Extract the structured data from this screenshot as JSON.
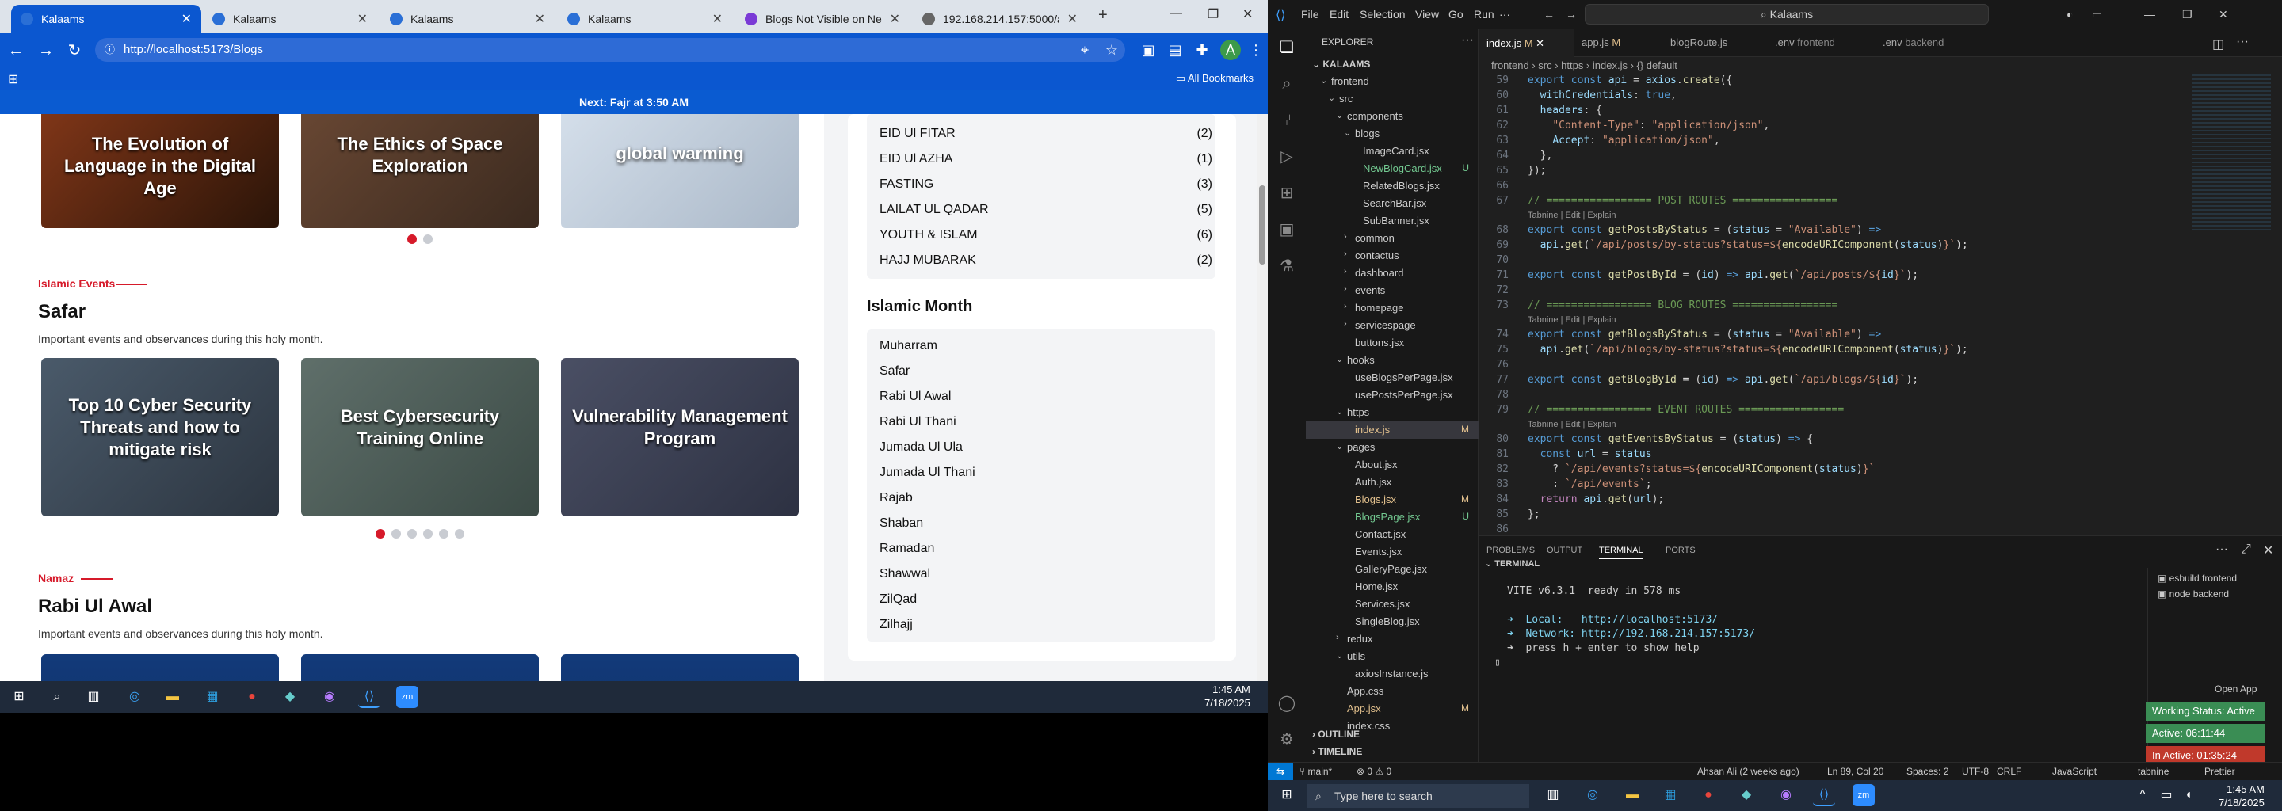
{
  "browser": {
    "tabs": [
      {
        "label": "Kalaams",
        "active": true
      },
      {
        "label": "Kalaams",
        "active": false
      },
      {
        "label": "Kalaams",
        "active": false
      },
      {
        "label": "Kalaams",
        "active": false
      },
      {
        "label": "Blogs Not Visible on Netwo",
        "active": false
      },
      {
        "label": "192.168.214.157:5000/api/b",
        "active": false
      }
    ],
    "url": "http://localhost:5173/Blogs",
    "all_bookmarks": "All Bookmarks",
    "site_banner": "Next: Fajr at 3:50 AM"
  },
  "main": {
    "top_cards": [
      "The Evolution of Language in the Digital Age",
      "The Ethics of Space Exploration",
      "global warming"
    ],
    "section1": {
      "tag": "Islamic Events",
      "title": "Safar",
      "subtitle": "Important events and observances during this holy month.",
      "cards": [
        "Top 10 Cyber Security Threats and how to mitigate risk",
        "Best Cybersecurity Training Online",
        "Vulnerability Management Program"
      ]
    },
    "section2": {
      "tag": "Namaz",
      "title": "Rabi Ul Awal",
      "subtitle": "Important events and observances during this holy month."
    }
  },
  "sidebar": {
    "categories": [
      {
        "name": "EID Ul FITAR",
        "count": "(2)"
      },
      {
        "name": "EID Ul AZHA",
        "count": "(1)"
      },
      {
        "name": "FASTING",
        "count": "(3)"
      },
      {
        "name": "LAILAT UL QADAR",
        "count": "(5)"
      },
      {
        "name": "YOUTH & ISLAM",
        "count": "(6)"
      },
      {
        "name": "HAJJ MUBARAK",
        "count": "(2)"
      }
    ],
    "month_title": "Islamic Month",
    "months": [
      "Muharram",
      "Safar",
      "Rabi Ul Awal",
      "Rabi Ul Thani",
      "Jumada Ul Ula",
      "Jumada Ul Thani",
      "Rajab",
      "Shaban",
      "Ramadan",
      "Shawwal",
      "ZilQad",
      "Zilhajj"
    ]
  },
  "taskbar_left": {
    "time": "1:45 AM",
    "date": "7/18/2025"
  },
  "vscode": {
    "menu": [
      "File",
      "Edit",
      "Selection",
      "View",
      "Go",
      "Run"
    ],
    "search": "Kalaams",
    "explorer_title": "EXPLORER",
    "root": "KALAAMS",
    "tree": [
      {
        "label": "frontend",
        "arrow": "⌄",
        "indent": 1,
        "status": ""
      },
      {
        "label": "src",
        "arrow": "⌄",
        "indent": 2,
        "status": ""
      },
      {
        "label": "components",
        "arrow": "⌄",
        "indent": 3,
        "status": ""
      },
      {
        "label": "blogs",
        "arrow": "⌄",
        "indent": 4,
        "status": ""
      },
      {
        "label": "ImageCard.jsx",
        "arrow": "",
        "indent": 5,
        "status": ""
      },
      {
        "label": "NewBlogCard.jsx",
        "arrow": "",
        "indent": 5,
        "status": "U"
      },
      {
        "label": "RelatedBlogs.jsx",
        "arrow": "",
        "indent": 5,
        "status": ""
      },
      {
        "label": "SearchBar.jsx",
        "arrow": "",
        "indent": 5,
        "status": ""
      },
      {
        "label": "SubBanner.jsx",
        "arrow": "",
        "indent": 5,
        "status": ""
      },
      {
        "label": "common",
        "arrow": "›",
        "indent": 4,
        "status": ""
      },
      {
        "label": "contactus",
        "arrow": "›",
        "indent": 4,
        "status": ""
      },
      {
        "label": "dashboard",
        "arrow": "›",
        "indent": 4,
        "status": ""
      },
      {
        "label": "events",
        "arrow": "›",
        "indent": 4,
        "status": ""
      },
      {
        "label": "homepage",
        "arrow": "›",
        "indent": 4,
        "status": ""
      },
      {
        "label": "servicespage",
        "arrow": "›",
        "indent": 4,
        "status": ""
      },
      {
        "label": "buttons.jsx",
        "arrow": "",
        "indent": 4,
        "status": ""
      },
      {
        "label": "hooks",
        "arrow": "⌄",
        "indent": 3,
        "status": ""
      },
      {
        "label": "useBlogsPerPage.jsx",
        "arrow": "",
        "indent": 4,
        "status": ""
      },
      {
        "label": "usePostsPerPage.jsx",
        "arrow": "",
        "indent": 4,
        "status": ""
      },
      {
        "label": "https",
        "arrow": "⌄",
        "indent": 3,
        "status": ""
      },
      {
        "label": "index.js",
        "arrow": "",
        "indent": 4,
        "status": "M"
      },
      {
        "label": "pages",
        "arrow": "⌄",
        "indent": 3,
        "status": ""
      },
      {
        "label": "About.jsx",
        "arrow": "",
        "indent": 4,
        "status": ""
      },
      {
        "label": "Auth.jsx",
        "arrow": "",
        "indent": 4,
        "status": ""
      },
      {
        "label": "Blogs.jsx",
        "arrow": "",
        "indent": 4,
        "status": "M"
      },
      {
        "label": "BlogsPage.jsx",
        "arrow": "",
        "indent": 4,
        "status": "U"
      },
      {
        "label": "Contact.jsx",
        "arrow": "",
        "indent": 4,
        "status": ""
      },
      {
        "label": "Events.jsx",
        "arrow": "",
        "indent": 4,
        "status": ""
      },
      {
        "label": "GalleryPage.jsx",
        "arrow": "",
        "indent": 4,
        "status": ""
      },
      {
        "label": "Home.jsx",
        "arrow": "",
        "indent": 4,
        "status": ""
      },
      {
        "label": "Services.jsx",
        "arrow": "",
        "indent": 4,
        "status": ""
      },
      {
        "label": "SingleBlog.jsx",
        "arrow": "",
        "indent": 4,
        "status": ""
      },
      {
        "label": "redux",
        "arrow": "›",
        "indent": 3,
        "status": ""
      },
      {
        "label": "utils",
        "arrow": "⌄",
        "indent": 3,
        "status": ""
      },
      {
        "label": "axiosInstance.js",
        "arrow": "",
        "indent": 4,
        "status": ""
      },
      {
        "label": "App.css",
        "arrow": "",
        "indent": 3,
        "status": ""
      },
      {
        "label": "App.jsx",
        "arrow": "",
        "indent": 3,
        "status": "M"
      },
      {
        "label": "index.css",
        "arrow": "",
        "indent": 3,
        "status": ""
      }
    ],
    "outline": "OUTLINE",
    "timeline": "TIMELINE",
    "editor_tabs": [
      {
        "label": "index.js",
        "status": "M",
        "active": true
      },
      {
        "label": "app.js",
        "status": "M",
        "active": false
      },
      {
        "label": "blogRoute.js",
        "status": "",
        "active": false
      },
      {
        "label": ".env",
        "status": "frontend",
        "active": false
      },
      {
        "label": ".env",
        "status": "backend",
        "active": false
      }
    ],
    "breadcrumb": "frontend › src › https › index.js › {} default",
    "panel_tabs": [
      "PROBLEMS",
      "OUTPUT",
      "TERMINAL",
      "PORTS"
    ],
    "terminal_title": "TERMINAL",
    "terminal_lines": [
      "VITE v6.3.1  ready in 578 ms",
      "",
      "➜  Local:   http://localhost:5173/",
      "➜  Network: http://192.168.214.157:5173/",
      "➜  press h + enter to show help"
    ],
    "terminal_list": [
      "esbuild  frontend",
      "node  backend"
    ],
    "open_app": "Open App",
    "working_status": "Working Status: Active",
    "active_time": "Active: 06:11:44",
    "inactive_time": "In Active: 01:35:24",
    "status": {
      "branch": "main*",
      "problems": "⊗ 0 ⚠ 0",
      "author": "Ahsan Ali (2 weeks ago)",
      "position": "Ln 89, Col 20",
      "spaces": "Spaces: 2",
      "encoding": "UTF-8",
      "eol": "CRLF",
      "language": "JavaScript",
      "tabnine": "tabnine",
      "prettier": "Prettier"
    }
  },
  "taskbar_right": {
    "search": "Type here to search",
    "time": "1:45 AM",
    "date": "7/18/2025"
  }
}
